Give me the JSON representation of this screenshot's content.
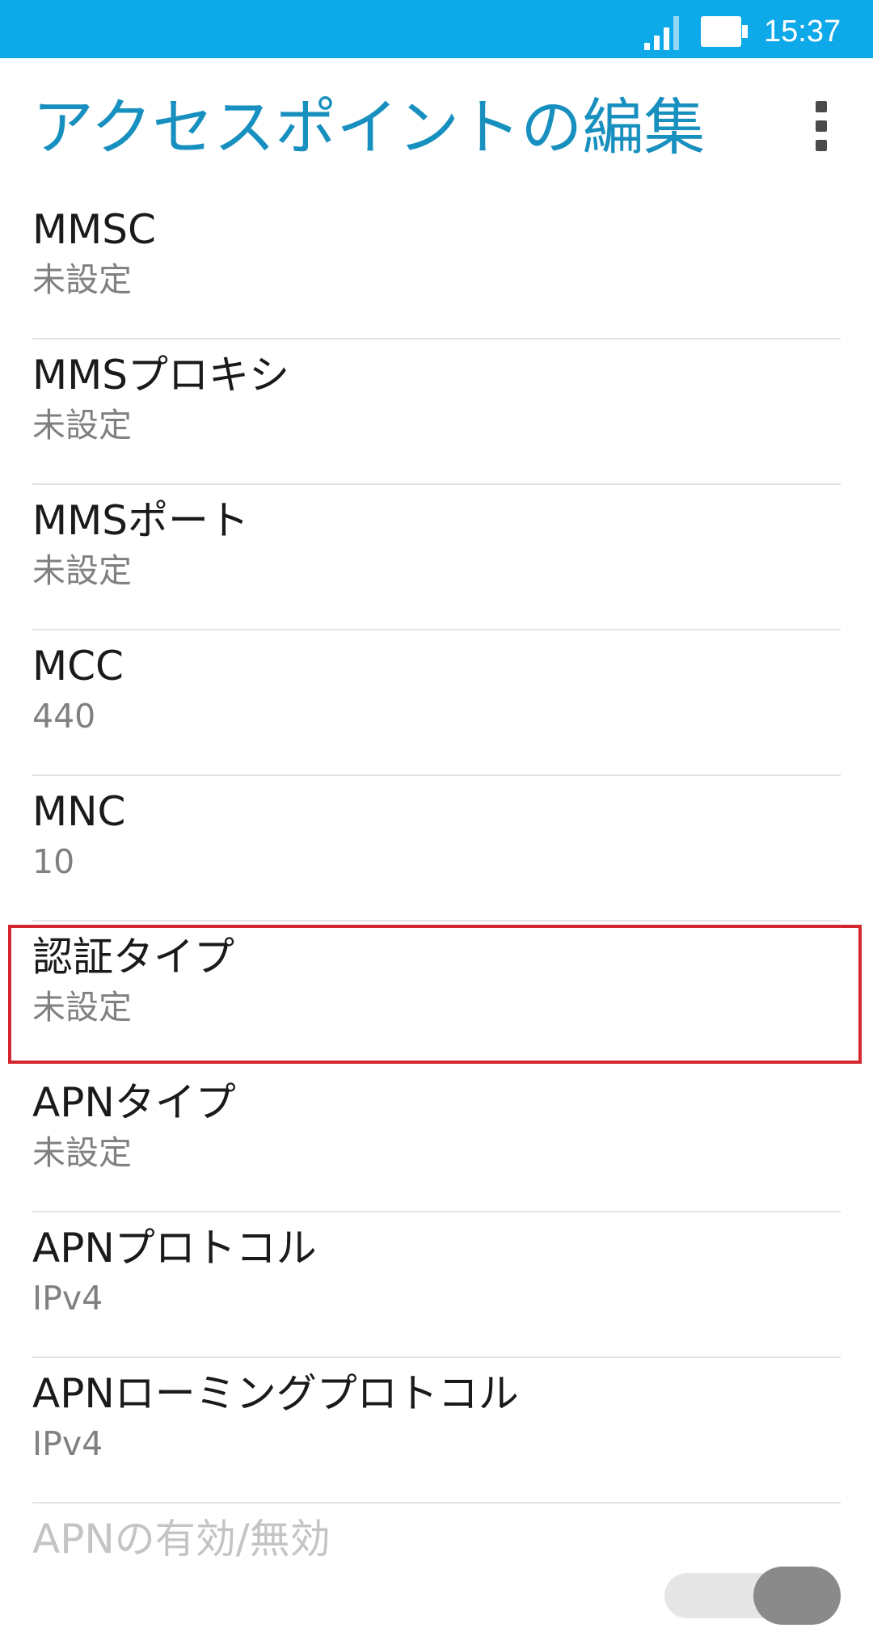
{
  "status_bar": {
    "time": "15:37",
    "icons": [
      "signal-icon",
      "battery-icon"
    ],
    "background_color": "#0ea9e9"
  },
  "header": {
    "title": "アクセスポイントの編集",
    "title_color": "#1890bf",
    "menu_icon": "more-vert-icon"
  },
  "settings": [
    {
      "title": "MMSC",
      "summary": "未設定"
    },
    {
      "title": "MMSプロキシ",
      "summary": "未設定"
    },
    {
      "title": "MMSポート",
      "summary": "未設定"
    },
    {
      "title": "MCC",
      "summary": "440"
    },
    {
      "title": "MNC",
      "summary": "10"
    },
    {
      "title": "認証タイプ",
      "summary": "未設定",
      "highlighted": true
    },
    {
      "title": "APNタイプ",
      "summary": "未設定"
    },
    {
      "title": "APNプロトコル",
      "summary": "IPv4"
    },
    {
      "title": "APNローミングプロトコル",
      "summary": "IPv4"
    }
  ],
  "apn_toggle": {
    "title": "APNの有効/無効",
    "enabled": false,
    "state": "off"
  },
  "colors": {
    "highlight_border": "#d4262e",
    "primary_text": "#1a1a1a",
    "secondary_text": "#808080",
    "divider": "#e2e2e2"
  }
}
